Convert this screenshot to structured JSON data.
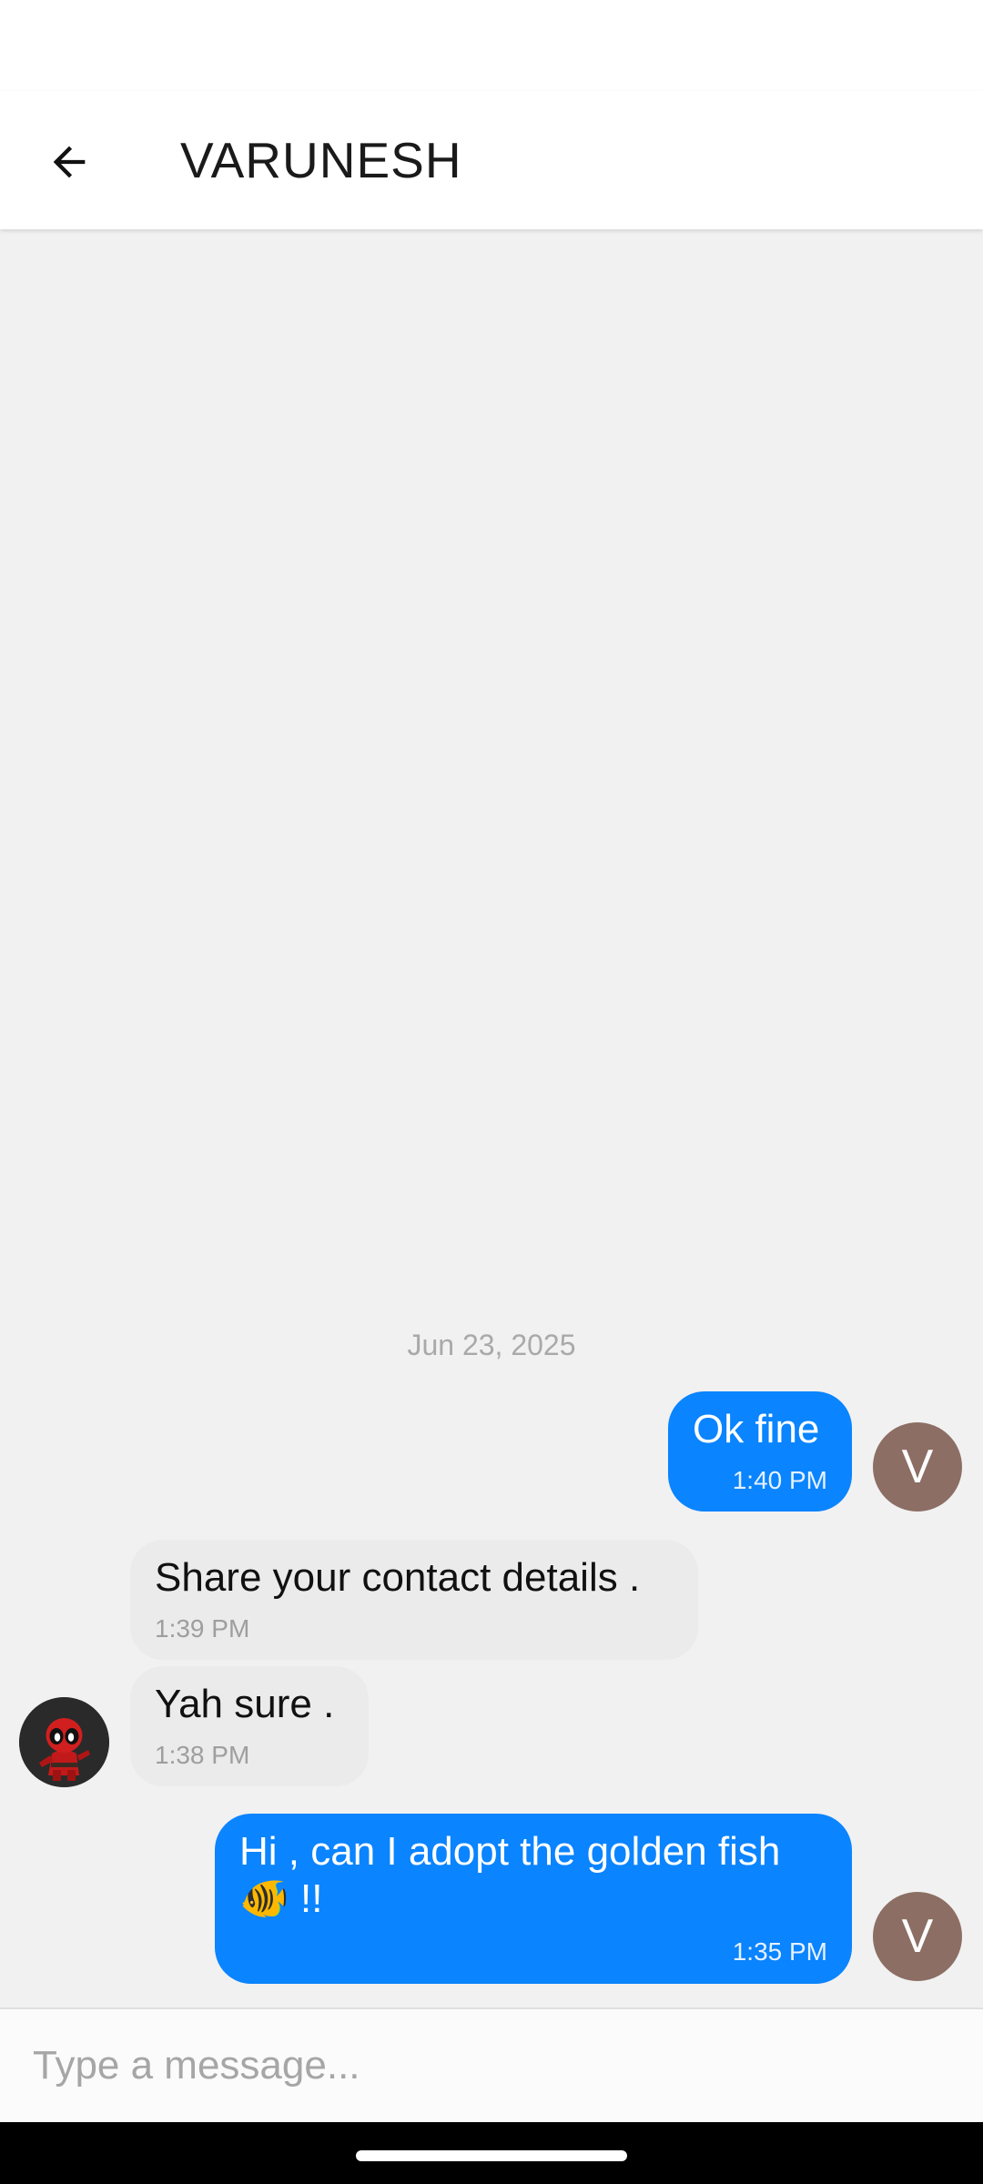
{
  "header": {
    "title": "VARUNESH",
    "back_icon": "arrow-left-icon"
  },
  "chat": {
    "date_divider": "Jun 23, 2025",
    "messages": [
      {
        "direction": "outgoing",
        "text": "Ok fine",
        "time": "1:40 PM",
        "avatar_letter": "V"
      },
      {
        "direction": "incoming",
        "text": "Share your contact details .",
        "time": "1:39 PM"
      },
      {
        "direction": "incoming",
        "text": "Yah sure .",
        "time": "1:38 PM"
      },
      {
        "direction": "outgoing",
        "text_line1": "Hi , can I adopt the golden fish",
        "text_line2": "🐠 !!",
        "time": "1:35 PM",
        "avatar_letter": "V"
      }
    ],
    "incoming_avatar": "deadpool-avatar-icon"
  },
  "composer": {
    "placeholder": "Type a message..."
  },
  "colors": {
    "outgoing_bubble": "#0a84ff",
    "incoming_bubble": "#ebebeb",
    "avatar": "#8c6e64",
    "background": "#f1f1f1"
  }
}
